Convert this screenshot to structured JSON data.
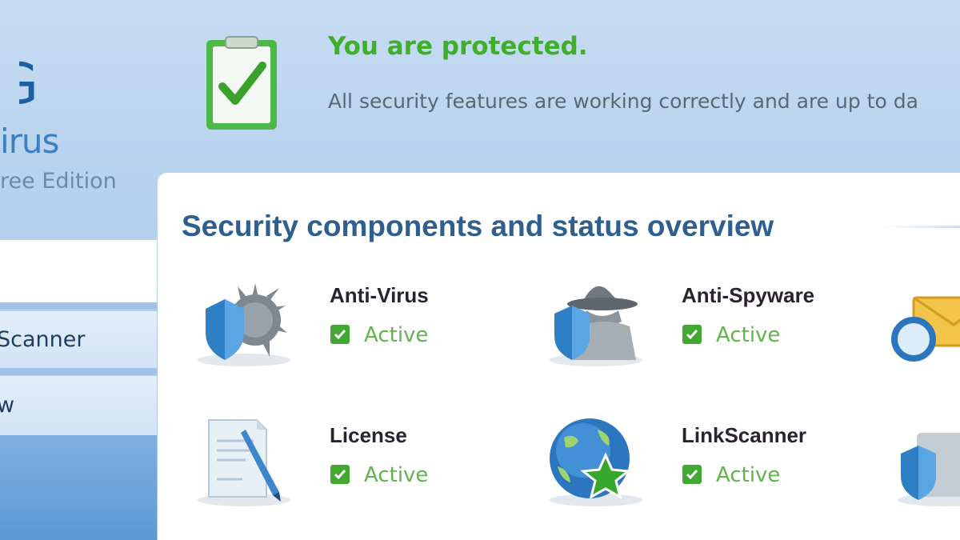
{
  "brand": {
    "logo_partial": "G",
    "product_partial": "irus",
    "edition_partial": "ree Edition"
  },
  "sidebar": {
    "items": [
      {
        "label": "Scanner",
        "icon": "linkscanner-nav"
      },
      {
        "label": "w",
        "icon": "overview-nav"
      }
    ]
  },
  "header": {
    "status_title": "You are protected.",
    "status_desc": "All security features are working correctly and are up to da",
    "status_icon": "clipboard-check-icon"
  },
  "main": {
    "section_title": "Security components and status overview",
    "components": [
      {
        "name": "Anti-Virus",
        "status": "Active",
        "icon": "anti-virus-icon"
      },
      {
        "name": "Anti-Spyware",
        "status": "Active",
        "icon": "anti-spyware-icon"
      },
      {
        "name": "License",
        "status": "Active",
        "icon": "license-icon"
      },
      {
        "name": "LinkScanner",
        "status": "Active",
        "icon": "linkscanner-icon"
      }
    ],
    "partial_components": [
      {
        "icon": "email-scanner-icon"
      },
      {
        "icon": "shield-component-icon"
      }
    ]
  },
  "colors": {
    "accent_blue": "#2f5f8e",
    "protected_green": "#3fae2a",
    "active_green": "#5fb44a",
    "sidebar_blue": "#5d98d5"
  }
}
